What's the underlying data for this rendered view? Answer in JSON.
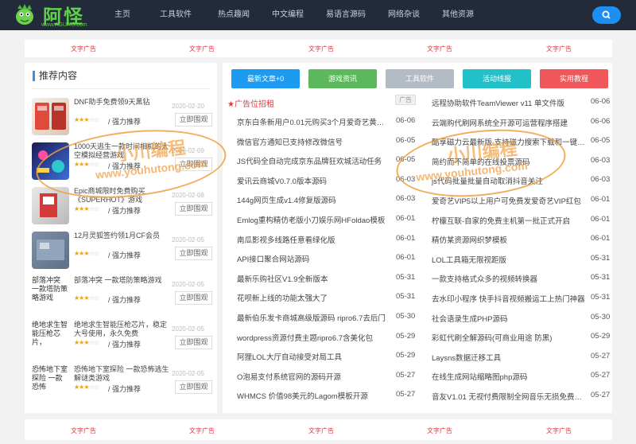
{
  "header": {
    "brand": "阿怪",
    "url": "www.AGUAI5.com",
    "nav": [
      "主页",
      "工具软件",
      "热点趣闻",
      "中文编程",
      "易语言源码",
      "网络杂谈",
      "其他资源"
    ],
    "search_icon": "search-icon"
  },
  "ads_top": [
    "文字广告",
    "文字广告",
    "文字广告",
    "文字广告",
    "文字广告"
  ],
  "ads_bottom": [
    "文字广告",
    "文字广告",
    "文字广告",
    "文字广告",
    "文字广告"
  ],
  "left": {
    "title": "推荐内容",
    "items": [
      {
        "title": "DNF助手免费领9天黑钻",
        "date": "2020-02-20",
        "rating": "/ 强力推荐",
        "view": "立即围观",
        "thumb_text": ""
      },
      {
        "title": "1000天逃生一款时间相机的太空模拟经营游戏",
        "date": "2020-02-09",
        "rating": "/ 强力推荐",
        "view": "立即围观",
        "thumb_text": ""
      },
      {
        "title": "Epic商城限时免费购买《SUPERHOT》游戏",
        "date": "2020-02-08",
        "rating": "/ 强力推荐",
        "view": "立即围观",
        "thumb_text": ""
      },
      {
        "title": "12月灵狐签约领1月CF会员",
        "date": "2020-02-05",
        "rating": "/ 强力推荐",
        "view": "立即围观",
        "thumb_text": ""
      },
      {
        "title": "部落冲突 一款塔防策略游戏",
        "date": "2020-02-05",
        "rating": "/ 强力推荐",
        "view": "立即围观",
        "thumb_text": "部落冲突 一款塔防策略游戏"
      },
      {
        "title": "绝地求生智能压枪芯片，稳定大号使用，永久免费",
        "date": "2020-02-05",
        "rating": "/ 强力推荐",
        "view": "立即围观",
        "thumb_text": "绝地求生智能压枪芯片，"
      },
      {
        "title": "恐怖地下室探险 一款恐怖逃生解谜类游戏",
        "date": "2020-02-05",
        "rating": "/ 强力推荐",
        "view": "立即围观",
        "thumb_text": "恐怖地下室探险 一款恐怖"
      }
    ]
  },
  "tabs": [
    {
      "label": "最新文章+0",
      "color": "#1d9bf0"
    },
    {
      "label": "游戏资讯",
      "color": "#5cb85c"
    },
    {
      "label": "工具软件",
      "color": "#b3bcc4"
    },
    {
      "label": "活动线报",
      "color": "#22c0c9"
    },
    {
      "label": "实用教程",
      "color": "#f0575a"
    }
  ],
  "left_col_head": "广告位招租",
  "left_col": [
    {
      "title": "京东白条新用户0.01元购买3个月爱奇艺黄金会员",
      "date": "06-06"
    },
    {
      "title": "微信官方通知已支持修改微信号",
      "date": "06-05"
    },
    {
      "title": "JS代码全自动完成京东品牌狂欢城活动任务",
      "date": "06-05"
    },
    {
      "title": "爱讯云商城V0.7.0版本源码",
      "date": "06-03"
    },
    {
      "title": "144g网页生成v1.4修复版源码",
      "date": "06-03"
    },
    {
      "title": "Emlog重构精仿老版小刀娱乐网HFoldao模板",
      "date": "06-01"
    },
    {
      "title": "南瓜影视多线路任意看绿化版",
      "date": "06-01"
    },
    {
      "title": "API接口聚合网站源码",
      "date": "06-01"
    },
    {
      "title": "最新乐购社区V1.9全新版本",
      "date": "05-31"
    },
    {
      "title": "花呗新上线的功能太强大了",
      "date": "05-31"
    },
    {
      "title": "最新伯乐发卡商城高级版源码 ripro6.7去后门",
      "date": "05-30"
    },
    {
      "title": "wordpress资源付费主题ripro6.7含美化包",
      "date": "05-29"
    },
    {
      "title": "阿狸LOL大厅自动接受对局工具",
      "date": "05-29"
    },
    {
      "title": "O泡易支付系统官网的源码开源",
      "date": "05-27"
    },
    {
      "title": "WHMCS 价值98美元的Lagom模板开源",
      "date": "05-27"
    }
  ],
  "right_col": [
    {
      "title": "远程协助软件TeamViewer v11 单文件版",
      "date": "06-06",
      "tag": "广告"
    },
    {
      "title": "云端购代刷网系统全开源可运营程序搭建",
      "date": "06-06"
    },
    {
      "title": "酷享磁力云最新版 支持磁力搜索下载和一键播放",
      "date": "06-05"
    },
    {
      "title": "简约而不简单的在线投票源码",
      "date": "06-03"
    },
    {
      "title": "js代码批量批量自动取消抖音关注",
      "date": "06-03"
    },
    {
      "title": "爱奇艺VIP5以上用户可免费发爱奇艺VIP红包",
      "date": "06-01"
    },
    {
      "title": "柠檬互联-自家的免费主机第一批正式开启",
      "date": "06-01"
    },
    {
      "title": "精仿某资源网织梦模板",
      "date": "06-01"
    },
    {
      "title": "LOL工具箱无限视距版",
      "date": "05-31"
    },
    {
      "title": "一款支持格式众多的视频转换器",
      "date": "05-31"
    },
    {
      "title": "去水印小程序 快手抖音视频搬运工上热门神器",
      "date": "05-31"
    },
    {
      "title": "社会语录生成PHP源码",
      "date": "05-30"
    },
    {
      "title": "彩虹代刷全解源码(可商业用途 防黑)",
      "date": "05-29"
    },
    {
      "title": "Laysns数据迁移工具",
      "date": "05-27"
    },
    {
      "title": "在线生成网站缩略图php源码",
      "date": "05-27"
    },
    {
      "title": "音友V1.01 无视付费限制全网音乐无损免费下载",
      "date": "05-27"
    }
  ],
  "watermark": {
    "cn": "小川编程",
    "en": "www.youhutong.com"
  },
  "colors": {
    "header_bg": "#232b3a",
    "accent": "#1d8ff0",
    "ad_red": "#e0393e",
    "star": "#f2a20a"
  }
}
